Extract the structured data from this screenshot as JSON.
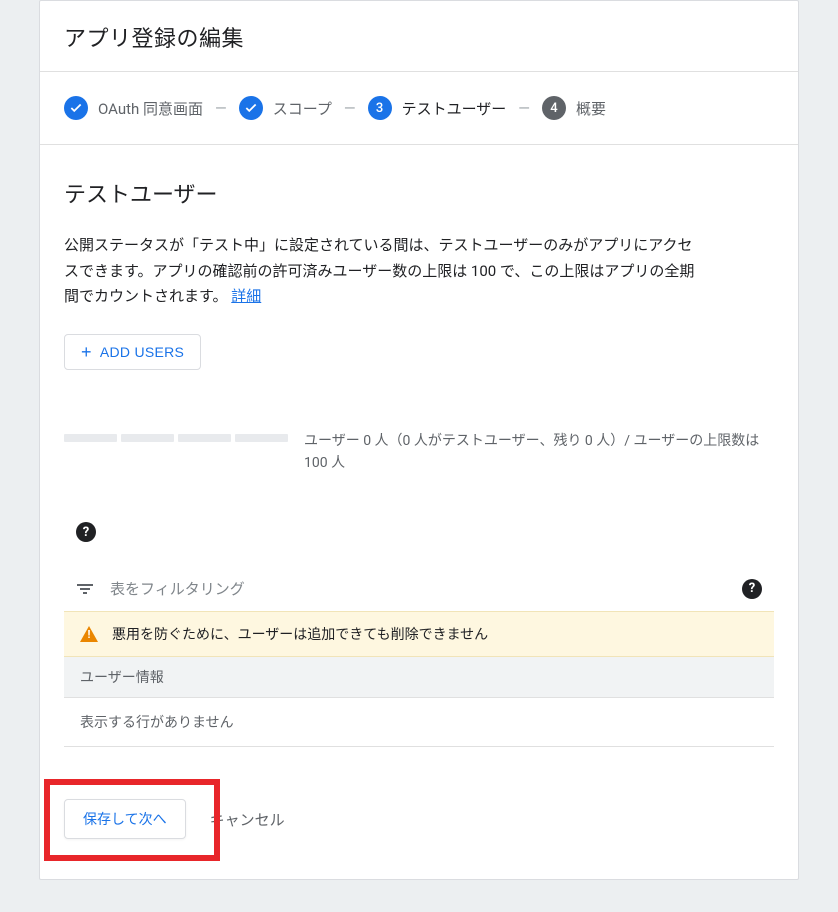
{
  "header": {
    "title": "アプリ登録の編集"
  },
  "stepper": {
    "steps": [
      {
        "label": "OAuth 同意画面",
        "state": "done"
      },
      {
        "label": "スコープ",
        "state": "done"
      },
      {
        "label": "テストユーザー",
        "state": "active",
        "num": "3"
      },
      {
        "label": "概要",
        "state": "inactive",
        "num": "4"
      }
    ]
  },
  "section": {
    "title": "テストユーザー",
    "desc_part1": "公開ステータスが「テスト中」に設定されている間は、テストユーザーのみがアプリにアクセスできます。アプリの確認前の許可済みユーザー数の上限は 100 で、この上限はアプリの全期間でカウントされます。 ",
    "link_label": "詳細"
  },
  "buttons": {
    "add_users": "ADD USERS",
    "save_next": "保存して次へ",
    "cancel": "キャンセル"
  },
  "quota": {
    "text": "ユーザー 0 人（0 人がテストユーザー、残り 0 人）/ ユーザーの上限数は 100 人"
  },
  "filter": {
    "placeholder": "表をフィルタリング"
  },
  "warning": {
    "text": "悪用を防ぐために、ユーザーは追加できても削除できません"
  },
  "table": {
    "header": "ユーザー情報",
    "empty": "表示する行がありません"
  }
}
